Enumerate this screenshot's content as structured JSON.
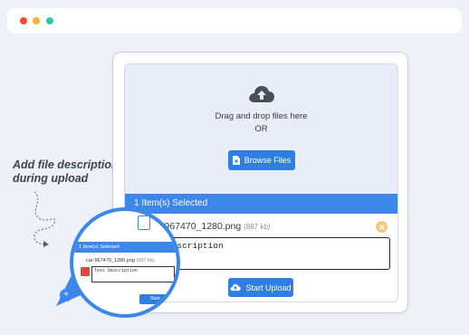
{
  "window": {
    "dots": [
      "red",
      "yellow",
      "green"
    ],
    "colors": {
      "red": "#ee4e3f",
      "yellow": "#f4b23c",
      "green": "#34c8a2"
    }
  },
  "caption": {
    "line1": "Add file description",
    "line2": "during upload"
  },
  "dropzone": {
    "icon": "cloud-upload-icon",
    "line1": "Drag and drop files here",
    "line2": "OR",
    "browse_label": "Browse Files"
  },
  "selection": {
    "header": "1 Item(s) Selected",
    "file_name": "-967470_1280.png",
    "file_size": "(887 kb)",
    "description_value": "Description",
    "upload_label": "Start Upload"
  },
  "magnifier": {
    "header": "1 Item(s) Selected",
    "file_name": "car-967470_1280.png",
    "file_size": "(887 kb)",
    "description_value": "Test Description",
    "upload_label": "Start"
  },
  "accent_color": "#3d86ea"
}
